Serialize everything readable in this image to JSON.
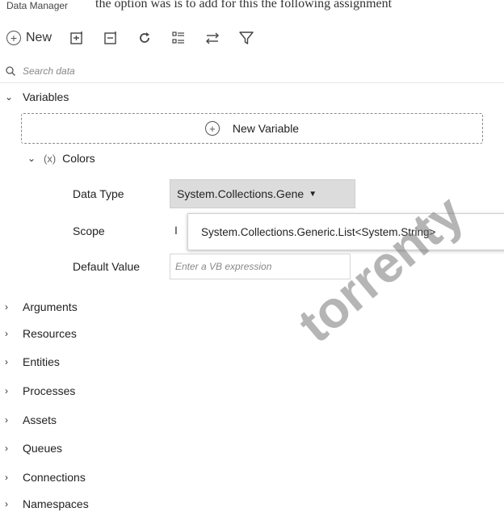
{
  "panel": {
    "title": "Data Manager",
    "top_text": "the option was is to add for this the following assignment"
  },
  "toolbar": {
    "new_label": "New",
    "icons": [
      "expand-all-icon",
      "collapse-all-icon",
      "refresh-icon",
      "list-view-icon",
      "sort-icon",
      "filter-icon"
    ]
  },
  "search": {
    "placeholder": "Search data"
  },
  "variables": {
    "label": "Variables",
    "new_variable_label": "New Variable",
    "colors": {
      "icon_text": "(x)",
      "name": "Colors",
      "data_type_label": "Data Type",
      "data_type_value": "System.Collections.Gene",
      "scope_label": "Scope",
      "scope_value": "I",
      "tooltip_text": "System.Collections.Generic.List<System.String>",
      "default_label": "Default Value",
      "default_placeholder": "Enter a VB expression"
    }
  },
  "sections": [
    "Arguments",
    "Resources",
    "Entities",
    "Processes",
    "Assets",
    "Queues",
    "Connections",
    "Namespaces"
  ],
  "watermark": "torrenty"
}
